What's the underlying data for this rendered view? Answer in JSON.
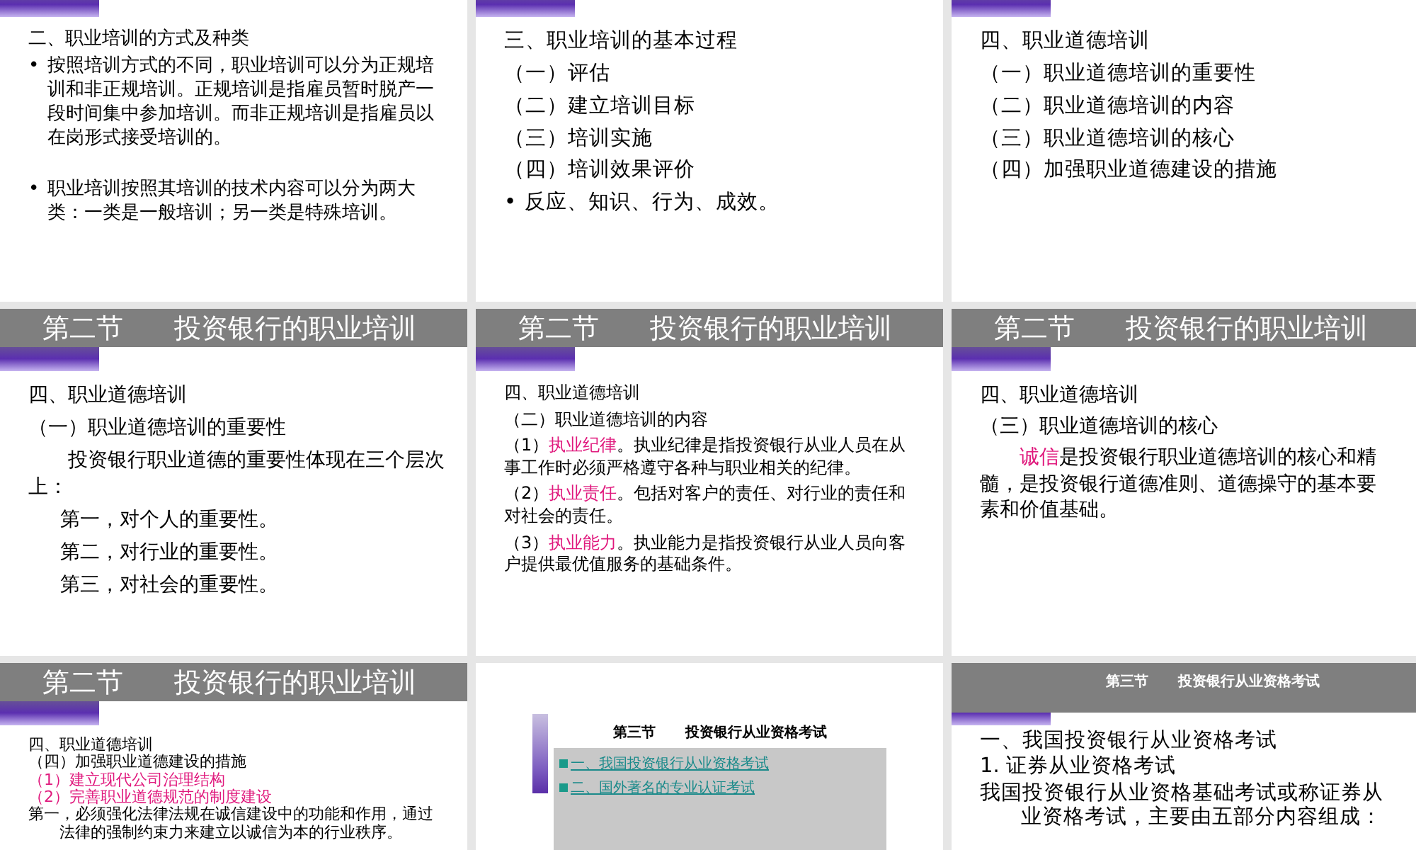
{
  "slides": [
    {
      "kind": "section",
      "lines": [
        {
          "kind": "heading",
          "text": "二、职业培训的方式及种类"
        },
        {
          "kind": "bullet",
          "marker": "•",
          "text": "按照培训方式的不同，职业培训可以分为正规培训和非正规培训。正规培训是指雇员暂时脱产一段时间集中参加培训。而非正规培训是指雇员以在岗形式接受培训的。"
        },
        {
          "kind": "gap"
        },
        {
          "kind": "bullet",
          "marker": "•",
          "text": "职业培训按照其培训的技术内容可以分为两大类：一类是一般培训；另一类是特殊培训。"
        }
      ]
    },
    {
      "kind": "section",
      "lines": [
        {
          "kind": "heading",
          "text": "三、职业培训的基本过程"
        },
        {
          "kind": "sub",
          "text": "（一）评估"
        },
        {
          "kind": "sub",
          "text": "（二）建立培训目标"
        },
        {
          "kind": "sub",
          "text": "（三）培训实施"
        },
        {
          "kind": "sub",
          "text": "（四）培训效果评价"
        },
        {
          "kind": "bullet",
          "marker": "•",
          "text": "反应、知识、行为、成效。"
        }
      ]
    },
    {
      "kind": "section",
      "lines": [
        {
          "kind": "heading",
          "text": "四、职业道德培训"
        },
        {
          "kind": "sub",
          "text": "（一）职业道德培训的重要性"
        },
        {
          "kind": "sub",
          "text": "（二）职业道德培训的内容"
        },
        {
          "kind": "sub",
          "text": "（三）职业道德培训的核心"
        },
        {
          "kind": "sub",
          "text": "（四）加强职业道德建设的措施"
        }
      ]
    },
    {
      "kind": "section",
      "title": "第二节      投资银行的职业培训",
      "lines": [
        {
          "kind": "heading",
          "text": "四、职业道德培训"
        },
        {
          "kind": "sub",
          "text": "（一）职业道德培训的重要性"
        },
        {
          "kind": "indent",
          "text": "投资银行职业道德的重要性体现在三个层次上："
        },
        {
          "kind": "item",
          "text": "第一，对个人的重要性。"
        },
        {
          "kind": "item",
          "text": "第二，对行业的重要性。"
        },
        {
          "kind": "item",
          "text": "第三，对社会的重要性。"
        }
      ]
    },
    {
      "kind": "section",
      "title": "第二节      投资银行的职业培训",
      "lines": [
        {
          "kind": "heading",
          "text": "四、职业道德培训"
        },
        {
          "kind": "sub",
          "text": "（二）职业道德培训的内容"
        },
        {
          "kind": "mixed",
          "prefix": "（1）",
          "highlight": "执业纪律",
          "text": "。执业纪律是指投资银行从业人员在从事工作时必须严格遵守各种与职业相关的纪律。"
        },
        {
          "kind": "mixed",
          "prefix": "（2）",
          "highlight": "执业责任",
          "text": "。包括对客户的责任、对行业的责任和对社会的责任。"
        },
        {
          "kind": "mixed",
          "prefix": "（3）",
          "highlight": "执业能力",
          "text": "。执业能力是指投资银行从业人员向客户提供最优值服务的基础条件。"
        }
      ]
    },
    {
      "kind": "section",
      "title": "第二节      投资银行的职业培训",
      "lines": [
        {
          "kind": "heading",
          "text": "四、职业道德培训"
        },
        {
          "kind": "sub",
          "text": "（三）职业道德培训的核心"
        },
        {
          "kind": "mixed",
          "highlight": "诚信",
          "text": "是投资银行职业道德培训的核心和精髓，是投资银行道德准则、道德操守的基本要素和价值基础。"
        }
      ]
    },
    {
      "kind": "section",
      "title": "第二节      投资银行的职业培训",
      "lines": [
        {
          "kind": "heading",
          "text": "四、职业道德培训"
        },
        {
          "kind": "sub",
          "text": "（四）加强职业道德建设的措施"
        },
        {
          "kind": "accent",
          "text": "（1）建立现代公司治理结构"
        },
        {
          "kind": "accent",
          "text": "（2）完善职业道德规范的制度建设"
        },
        {
          "kind": "hanging",
          "text": "第一，必须强化法律法规在诚信建设中的功能和作用，通过法律的强制约束力来建立以诚信为本的行业秩序。"
        }
      ]
    },
    {
      "kind": "inset",
      "title": "第三节      投资银行从业资格考试",
      "links": [
        "一、我国投资银行从业资格考试",
        "二、国外著名的专业认证考试"
      ]
    },
    {
      "kind": "banner",
      "title": "第三节      投资银行从业资格考试",
      "lines": [
        {
          "kind": "heading",
          "text": "一、我国投资银行从业资格考试"
        },
        {
          "kind": "heading",
          "text": "1. 证券从业资格考试"
        },
        {
          "kind": "hanging",
          "text": "我国投资银行从业资格基础考试或称证券从业资格考试，主要由五部分内容组成："
        }
      ]
    }
  ]
}
